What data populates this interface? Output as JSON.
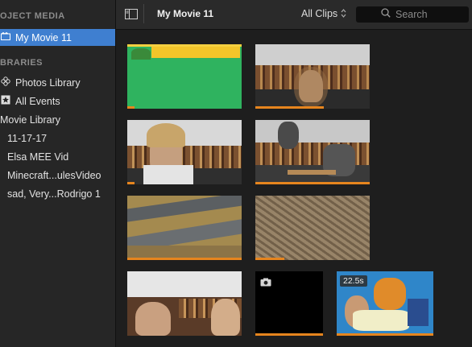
{
  "sidebar": {
    "project_media_header": "OJECT MEDIA",
    "project": "My Movie 11",
    "libraries_header": "BRARIES",
    "items": [
      {
        "label": "Photos Library",
        "icon": "flower-icon"
      },
      {
        "label": "All Events",
        "icon": "star-icon"
      },
      {
        "label": "Movie Library",
        "icon": ""
      },
      {
        "label": "11-17-17",
        "icon": ""
      },
      {
        "label": "Elsa MEE Vid",
        "icon": ""
      },
      {
        "label": "Minecraft...ulesVideo",
        "icon": ""
      },
      {
        "label": "sad, Very...Rodrigo 1",
        "icon": ""
      }
    ]
  },
  "toolbar": {
    "title": "My Movie 11",
    "filter": "All Clips",
    "search_placeholder": "Search"
  },
  "clips": [
    {
      "id": "clip-1",
      "used_fraction": 0.06
    },
    {
      "id": "clip-2",
      "used_fraction": 0.6
    },
    {
      "id": "clip-3",
      "used_fraction": 0.06
    },
    {
      "id": "clip-4",
      "used_fraction": 1.0
    },
    {
      "id": "clip-5",
      "used_fraction": 1.0
    },
    {
      "id": "clip-6",
      "used_fraction": 0.25
    },
    {
      "id": "clip-7",
      "used_fraction": 0.0
    },
    {
      "id": "clip-8",
      "used_fraction": 1.0
    },
    {
      "id": "clip-9",
      "used_fraction": 1.0,
      "duration": "22.5s"
    }
  ],
  "colors": {
    "accent": "#3f7fd0",
    "clip_used": "#e6851e"
  }
}
